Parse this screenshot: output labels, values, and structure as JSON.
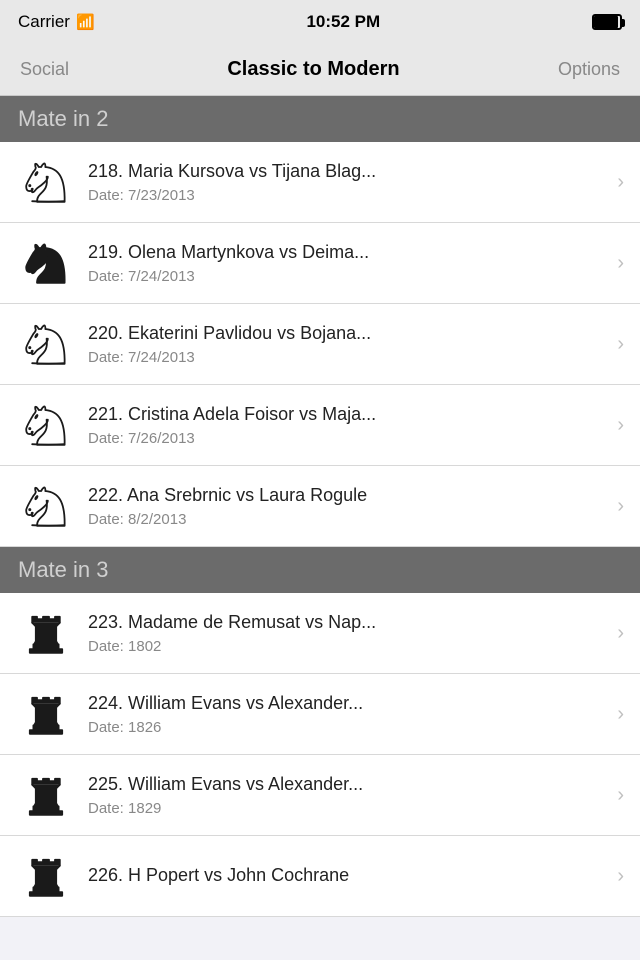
{
  "statusBar": {
    "carrier": "Carrier",
    "time": "10:52 PM"
  },
  "navBar": {
    "leftLabel": "Social",
    "title": "Classic to Modern",
    "rightLabel": "Options"
  },
  "sections": [
    {
      "header": "Mate in 2",
      "pieceType": "knight",
      "items": [
        {
          "id": 218,
          "title": "218. Maria Kursova vs Tijana Blag...",
          "subtitle": "Date: 7/23/2013"
        },
        {
          "id": 219,
          "title": "219. Olena Martynkova vs Deima...",
          "subtitle": "Date: 7/24/2013"
        },
        {
          "id": 220,
          "title": "220. Ekaterini Pavlidou vs Bojana...",
          "subtitle": "Date: 7/24/2013"
        },
        {
          "id": 221,
          "title": "221. Cristina Adela Foisor vs Maja...",
          "subtitle": "Date: 7/26/2013"
        },
        {
          "id": 222,
          "title": "222. Ana Srebrnic vs Laura Rogule",
          "subtitle": "Date: 8/2/2013"
        }
      ]
    },
    {
      "header": "Mate in 3",
      "pieceType": "rook",
      "items": [
        {
          "id": 223,
          "title": "223. Madame de Remusat vs Nap...",
          "subtitle": "Date: 1802"
        },
        {
          "id": 224,
          "title": "224. William Evans vs Alexander...",
          "subtitle": "Date: 1826"
        },
        {
          "id": 225,
          "title": "225. William Evans vs Alexander...",
          "subtitle": "Date: 1829"
        },
        {
          "id": 226,
          "title": "226. H Popert vs John Cochrane",
          "subtitle": ""
        }
      ]
    }
  ],
  "chevron": "›"
}
